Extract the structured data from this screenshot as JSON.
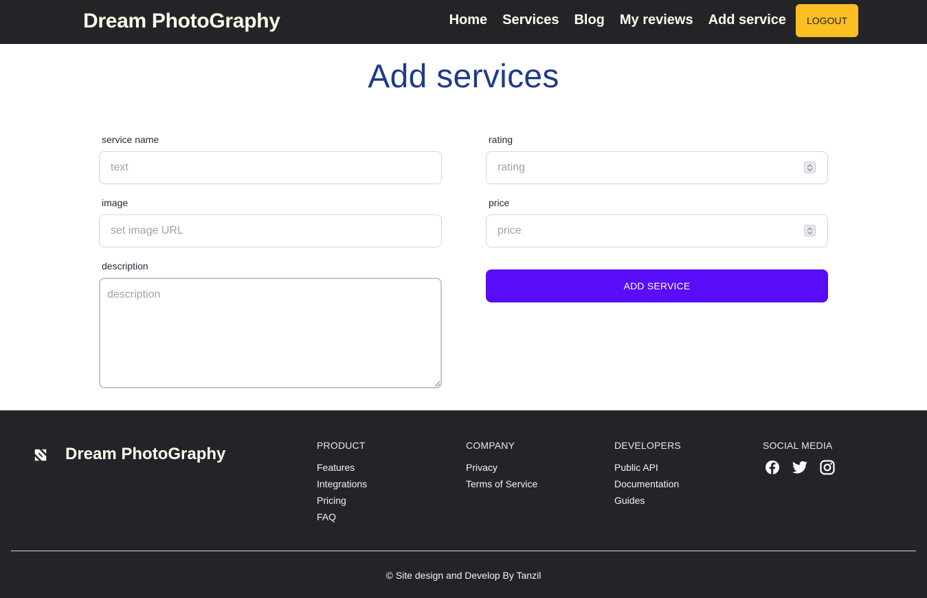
{
  "header": {
    "brand": "Dream PhotoGraphy",
    "nav": [
      "Home",
      "Services",
      "Blog",
      "My reviews",
      "Add service"
    ],
    "logout_label": "LOGOUT"
  },
  "main": {
    "title": "Add services",
    "form": {
      "service_name_label": "service name",
      "service_name_placeholder": "text",
      "image_label": "image",
      "image_placeholder": "set image URL",
      "description_label": "description",
      "description_placeholder": "description",
      "rating_label": "rating",
      "rating_placeholder": "rating",
      "price_label": "price",
      "price_placeholder": "price",
      "submit_label": "ADD SERVICE"
    }
  },
  "footer": {
    "brand": "Dream PhotoGraphy",
    "product_heading": "PRODUCT",
    "product_links": [
      "Features",
      "Integrations",
      "Pricing",
      "FAQ"
    ],
    "company_heading": "COMPANY",
    "company_links": [
      "Privacy",
      "Terms of Service"
    ],
    "developers_heading": "DEVELOPERS",
    "developers_links": [
      "Public API",
      "Documentation",
      "Guides"
    ],
    "social_heading": "SOCIAL MEDIA",
    "social_icons": [
      "facebook-icon",
      "twitter-icon",
      "instagram-icon"
    ],
    "copyright": "© Site design and Develop By Tanzil"
  },
  "colors": {
    "header_bg": "#242428",
    "title": "#1e3a8a",
    "logout_bg": "#fbbf24",
    "primary_button": "#570df8"
  }
}
